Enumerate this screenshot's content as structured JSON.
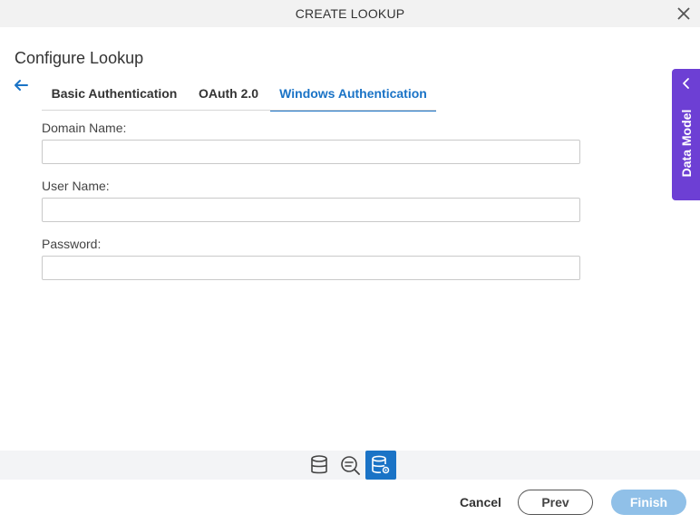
{
  "window": {
    "title": "CREATE LOOKUP",
    "close_icon": "close-icon"
  },
  "page": {
    "heading": "Configure Lookup"
  },
  "tabs": [
    {
      "label": "Basic Authentication",
      "active": false
    },
    {
      "label": "OAuth 2.0",
      "active": false
    },
    {
      "label": "Windows Authentication",
      "active": true
    }
  ],
  "form": {
    "domain": {
      "label": "Domain Name:",
      "value": ""
    },
    "user": {
      "label": "User Name:",
      "value": ""
    },
    "password": {
      "label": "Password:",
      "value": ""
    }
  },
  "side_panel": {
    "label": "Data Model"
  },
  "steps": [
    {
      "icon": "database-icon",
      "active": false
    },
    {
      "icon": "search-filter-icon",
      "active": false
    },
    {
      "icon": "database-settings-icon",
      "active": true
    }
  ],
  "footer": {
    "cancel_label": "Cancel",
    "prev_label": "Prev",
    "finish_label": "Finish"
  },
  "colors": {
    "accent": "#1a73c6",
    "side_panel": "#6d3fd4",
    "finish_disabled": "#90c0e8"
  }
}
